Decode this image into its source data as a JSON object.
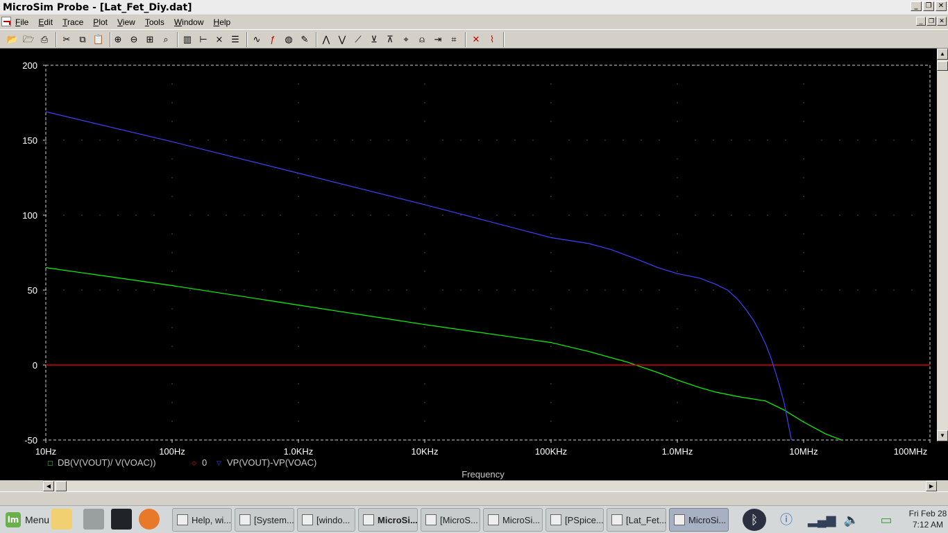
{
  "window": {
    "title": "MicroSim Probe - [Lat_Fet_Diy.dat]",
    "buttons": {
      "minimize": "_",
      "restore": "❐",
      "close": "✕"
    }
  },
  "menus": [
    "File",
    "Edit",
    "Trace",
    "Plot",
    "View",
    "Tools",
    "Window",
    "Help"
  ],
  "mdi_buttons": {
    "minimize": "_",
    "restore": "❐",
    "close": "✕"
  },
  "toolbar": {
    "groups": [
      [
        "open-icon",
        "open-dir-icon",
        "print-icon"
      ],
      [
        "cut-icon",
        "copy-icon",
        "paste-icon"
      ],
      [
        "zoom-in-icon",
        "zoom-out-icon",
        "zoom-area-icon",
        "zoom-fit-icon"
      ],
      [
        "axis-settings-icon",
        "add-y-axis-icon",
        "add-plot-icon",
        "fft-icon"
      ],
      [
        "add-trace-icon",
        "eval-goal-icon",
        "color-trace-icon",
        "label-icon"
      ],
      [
        "cursor-peak-icon",
        "cursor-trough-icon",
        "cursor-slope-icon",
        "cursor-min-icon",
        "cursor-max-icon",
        "cursor-point-icon",
        "cursor-search-icon",
        "cursor-next-icon",
        "cursor-mark-icon"
      ],
      [
        "mark-data-icon",
        "display-cursor-icon"
      ]
    ]
  },
  "chart_data": {
    "type": "line",
    "xlabel": "Frequency",
    "xscale": "log",
    "xlim": [
      10,
      100000000
    ],
    "x_ticks": [
      "10Hz",
      "100Hz",
      "1.0KHz",
      "10KHz",
      "100KHz",
      "1.0MHz",
      "10MHz",
      "100MHz"
    ],
    "ylim": [
      -50,
      200
    ],
    "y_ticks": [
      "200",
      "150",
      "100",
      "50",
      "0",
      "-50"
    ],
    "grid": "dotted",
    "legend_placement": "bottom-left",
    "series": [
      {
        "name": "DB(V(VOUT)/ V(VOAC))",
        "marker": "□",
        "color": "#00ff00",
        "x": [
          10,
          100,
          1000,
          10000,
          100000,
          200000,
          400000,
          700000,
          1000000,
          1500000,
          2000000,
          3000000,
          5000000,
          7000000,
          10000000,
          15000000,
          20000000
        ],
        "y": [
          65,
          53,
          40,
          27,
          15,
          9,
          2,
          -5,
          -10,
          -15,
          -18,
          -21,
          -24,
          -30,
          -38,
          -46,
          -50
        ]
      },
      {
        "name": "0",
        "marker": "◇",
        "color": "#ff0000",
        "x": [
          10,
          100000000
        ],
        "y": [
          0,
          0
        ]
      },
      {
        "name": "VP(VOUT)-VP(VOAC)",
        "marker": "▽",
        "color": "#4040ff",
        "x": [
          10,
          100,
          1000,
          10000,
          100000,
          200000,
          300000,
          500000,
          700000,
          1000000,
          1500000,
          2000000,
          2500000,
          3000000,
          3500000,
          4000000,
          4500000,
          5000000,
          5500000,
          6000000,
          6500000,
          7000000,
          8000000
        ],
        "y": [
          169,
          149,
          128,
          107,
          85,
          81,
          77,
          70,
          65,
          61,
          58,
          54,
          50,
          44,
          37,
          30,
          22,
          14,
          5,
          -5,
          -15,
          -25,
          -50
        ]
      }
    ]
  },
  "taskbar": {
    "menu_label": "Menu",
    "launchers": [
      "files-icon",
      "drive-icon",
      "terminal-icon",
      "firefox-icon"
    ],
    "tasks": [
      {
        "label": "Help, wi...",
        "icon": "firefox-icon"
      },
      {
        "label": "[System...",
        "icon": "system-monitor-icon"
      },
      {
        "label": "[windo...",
        "icon": "folder-icon"
      },
      {
        "label": "MicroSi...",
        "icon": "microsim-icon"
      },
      {
        "label": "[MicroS...",
        "icon": "microsim-icon"
      },
      {
        "label": "MicroSi...",
        "icon": "microsim-icon"
      },
      {
        "label": "[PSpice...",
        "icon": "pspice-icon"
      },
      {
        "label": "[Lat_Fet...",
        "icon": "document-icon"
      },
      {
        "label": "MicroSi...",
        "icon": "probe-icon"
      }
    ],
    "tray": [
      "bluetooth-icon",
      "shield-info-icon",
      "network-signal-icon",
      "volume-icon",
      "battery-icon"
    ],
    "clock_day": "Fri Feb 28",
    "clock_time": "7:12 AM"
  }
}
